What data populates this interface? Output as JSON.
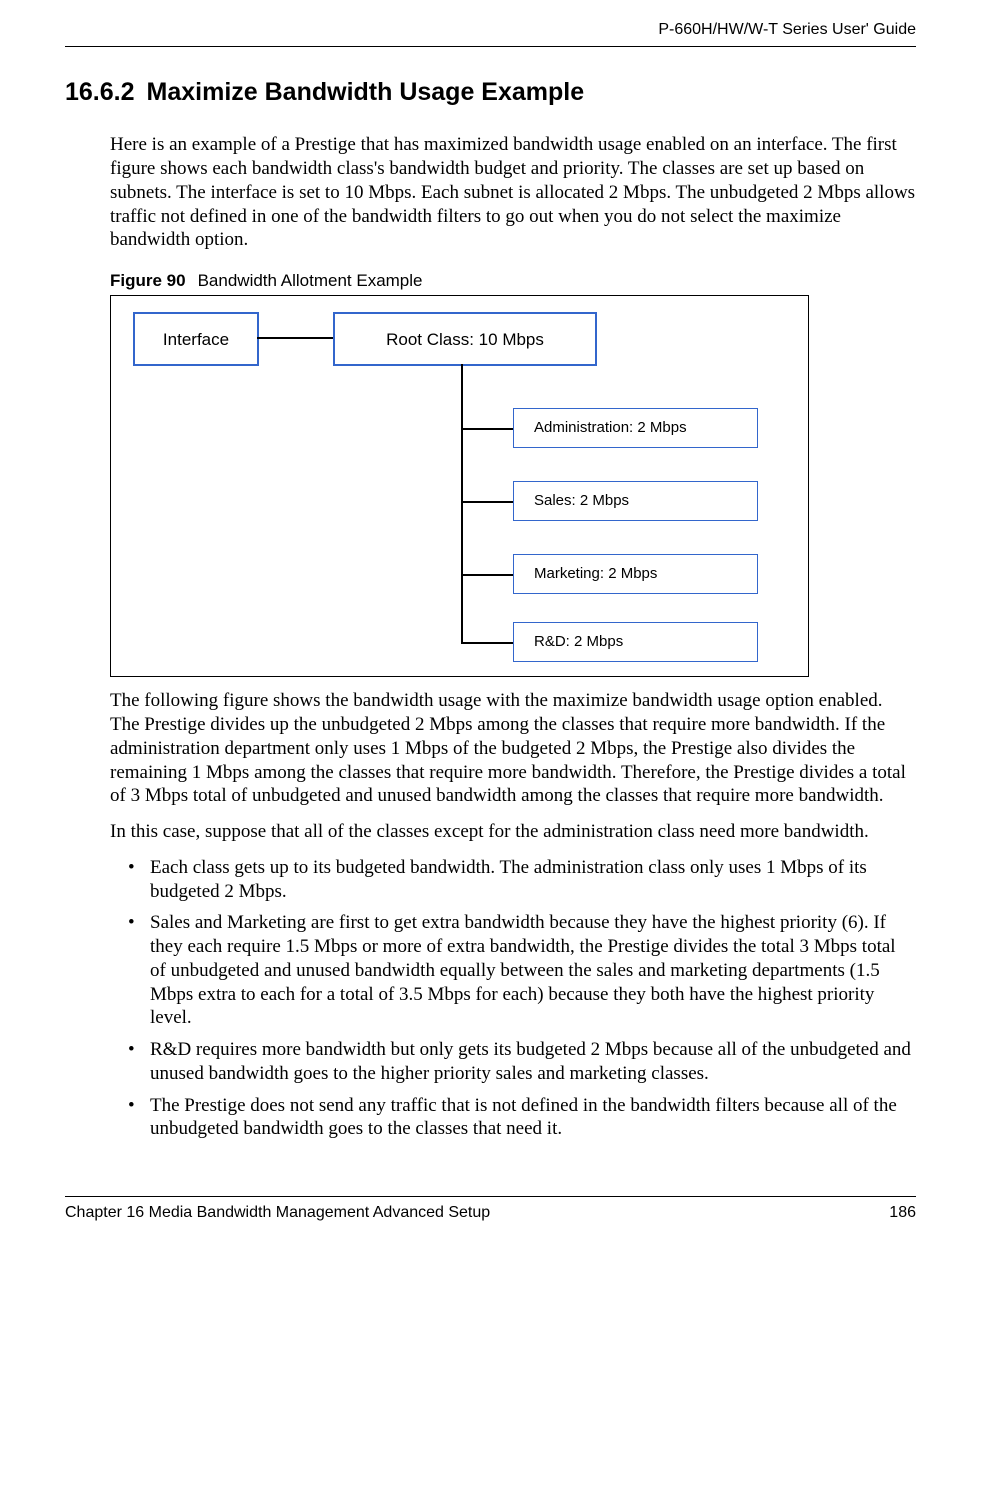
{
  "header": {
    "guide_title": "P-660H/HW/W-T Series User' Guide"
  },
  "section": {
    "number": "16.6.2",
    "title": "Maximize Bandwidth Usage Example"
  },
  "paragraphs": {
    "p1": "Here is an example of a Prestige that has maximized bandwidth usage enabled on an interface. The first figure shows each bandwidth class's bandwidth budget and priority. The classes are set up based on subnets. The interface is set to 10 Mbps. Each subnet is allocated 2 Mbps. The unbudgeted 2 Mbps allows traffic not defined in one of the bandwidth filters to go out when you do not select the maximize bandwidth option.",
    "p2": "The following figure shows the bandwidth usage with the maximize bandwidth usage option enabled. The Prestige divides up the unbudgeted 2 Mbps among the classes that require more bandwidth. If the administration department only uses 1 Mbps of the budgeted 2 Mbps, the Prestige also divides the remaining 1 Mbps among the classes that require more bandwidth. Therefore, the Prestige divides a total of 3 Mbps total of unbudgeted and unused bandwidth among the classes that require more bandwidth.",
    "p3": "In this case, suppose that all of the classes except for the administration class need more bandwidth."
  },
  "figure": {
    "label": "Figure 90",
    "caption": "Bandwidth Allotment Example",
    "interface_label": "Interface",
    "root_label": "Root Class: 10 Mbps",
    "children": {
      "admin": "Administration: 2 Mbps",
      "sales": "Sales: 2 Mbps",
      "marketing": "Marketing: 2 Mbps",
      "rd": "R&D: 2 Mbps"
    }
  },
  "bullets": {
    "b1": "Each class gets up to its budgeted bandwidth. The administration class only uses 1 Mbps of its budgeted 2 Mbps.",
    "b2": "Sales and Marketing are first to get extra bandwidth because they have the highest priority (6). If they each require 1.5 Mbps or more of extra bandwidth, the Prestige divides the total 3 Mbps total of unbudgeted and unused bandwidth equally between the sales and marketing departments (1.5 Mbps extra to each for a total of 3.5 Mbps for each) because they both have the highest priority level.",
    "b3": "R&D requires more bandwidth but only gets its budgeted 2 Mbps because all of the unbudgeted and unused bandwidth goes to the higher priority sales and marketing classes.",
    "b4": "The Prestige does not send any traffic that is not defined in the bandwidth filters because all of the unbudgeted bandwidth goes to the classes that need it."
  },
  "footer": {
    "chapter": "Chapter 16 Media Bandwidth Management Advanced Setup",
    "page_number": "186"
  }
}
